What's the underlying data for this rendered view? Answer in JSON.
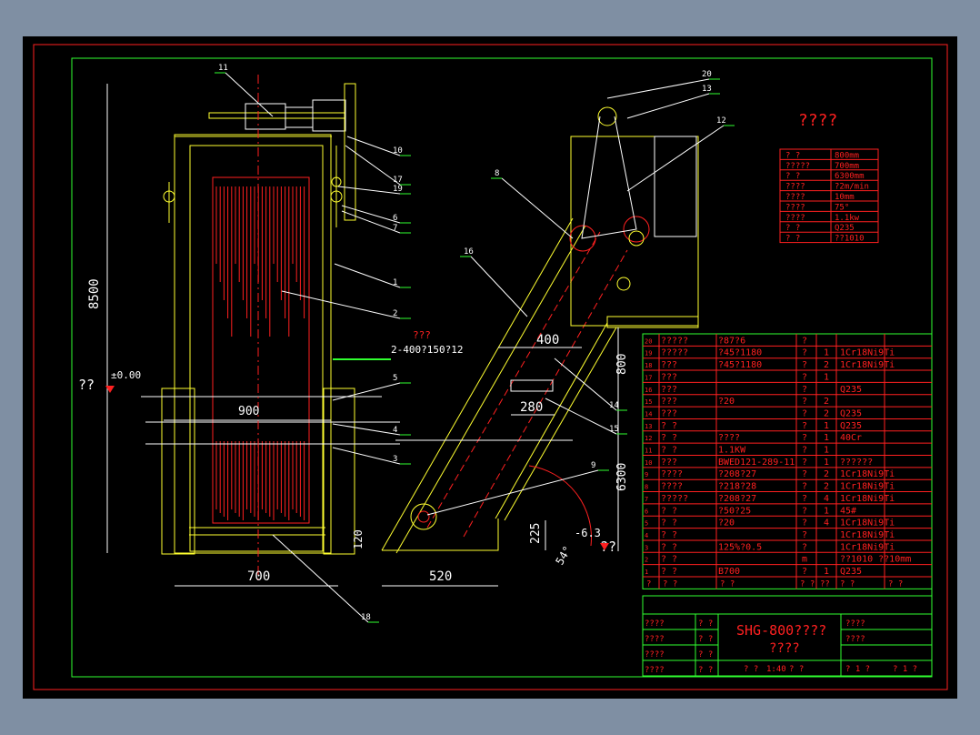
{
  "colors": {
    "background": "#7f8fa3",
    "sheet": "#000000",
    "frame": "#ff2020",
    "inner_frame": "#30ff30",
    "part_lines": "#ffff30",
    "leaders": "#ffffff"
  },
  "drawing": {
    "tech_title": "????",
    "params": [
      [
        "? ?",
        "800mm"
      ],
      [
        "?????",
        "700mm"
      ],
      [
        "? ?",
        "6300mm"
      ],
      [
        "????",
        "?2m/min"
      ],
      [
        "????",
        "10mm"
      ],
      [
        "????",
        "75°"
      ],
      [
        "????",
        "1.1kw"
      ],
      [
        "? ?",
        "Q235"
      ],
      [
        "? ?",
        "??1010"
      ]
    ],
    "balloons": [
      "11",
      "10",
      "17",
      "19",
      "6",
      "7",
      "1",
      "2",
      "5",
      "4",
      "3",
      "18",
      "20",
      "13",
      "12",
      "8",
      "16",
      "14",
      "15",
      "9"
    ],
    "dims": {
      "h8500": "8500",
      "w900": "900",
      "w700": "700",
      "w520": "520",
      "w400": "400",
      "w280": "280",
      "h800": "800",
      "h6300": "6300",
      "h225": "225",
      "h120": "120",
      "a54": "54°",
      "e63": "-6.3",
      "e000": "±0.00",
      "level_left": "??",
      "level_right": "??",
      "hole_note_1": "???",
      "hole_note_2": "2-400?150?12"
    },
    "bom": [
      [
        "20",
        "?????",
        "?87?6",
        "?",
        "",
        ""
      ],
      [
        "19",
        "?????",
        "?45?1180",
        "?",
        "1",
        "1Cr18Ni9Ti"
      ],
      [
        "18",
        "???",
        "?45?1180",
        "?",
        "2",
        "1Cr18Ni9Ti"
      ],
      [
        "17",
        "???",
        "",
        "?",
        "1",
        ""
      ],
      [
        "16",
        "???",
        "",
        "?",
        "",
        "Q235"
      ],
      [
        "15",
        "???",
        "?20",
        "?",
        "2",
        ""
      ],
      [
        "14",
        "???",
        "",
        "?",
        "2",
        "Q235"
      ],
      [
        "13",
        "? ?",
        "",
        "?",
        "1",
        "Q235"
      ],
      [
        "12",
        "? ?",
        "????",
        "?",
        "1",
        "40Cr"
      ],
      [
        "11",
        "? ?",
        "1.1KW",
        "?",
        "1",
        ""
      ],
      [
        "10",
        "???",
        "BWED121-289-11",
        "?",
        "1",
        "??????"
      ],
      [
        "9",
        "????",
        "?208?27",
        "?",
        "2",
        "1Cr18Ni9Ti"
      ],
      [
        "8",
        "????",
        "?218?28",
        "?",
        "2",
        "1Cr18Ni9Ti"
      ],
      [
        "7",
        "?????",
        "?208?27",
        "?",
        "4",
        "1Cr18Ni9Ti"
      ],
      [
        "6",
        "? ?",
        "?50?25",
        "?",
        "1",
        "45#"
      ],
      [
        "5",
        "? ?",
        "?20",
        "?",
        "4",
        "1Cr18Ni9Ti"
      ],
      [
        "4",
        "? ?",
        "",
        "?",
        "",
        "1Cr18Ni9Ti"
      ],
      [
        "3",
        "? ?",
        "125%?0.5",
        "?",
        "",
        "1Cr18Ni9Ti"
      ],
      [
        "2",
        "? ?",
        "",
        "m",
        "",
        "??1010  ??10mm"
      ],
      [
        "1",
        "? ?",
        "B700",
        "?",
        "1",
        "Q235"
      ]
    ],
    "bom_header": [
      "?",
      "? ?",
      "? ?",
      "? ?",
      "??",
      "? ?",
      "? ?"
    ],
    "title_block": {
      "main_title": "SHG-800????",
      "sub_title": "????",
      "left_rows": [
        "????",
        "????",
        "????",
        "????"
      ],
      "left_mid": [
        "? ?",
        "? ?",
        "? ?",
        "? ?"
      ],
      "right_rows": [
        "????",
        "????"
      ],
      "scale_label": "1:40",
      "cell_a": "? ?",
      "cell_b": "? ?",
      "sheet_a": "? 1 ?",
      "sheet_b": "? 1 ?"
    }
  }
}
